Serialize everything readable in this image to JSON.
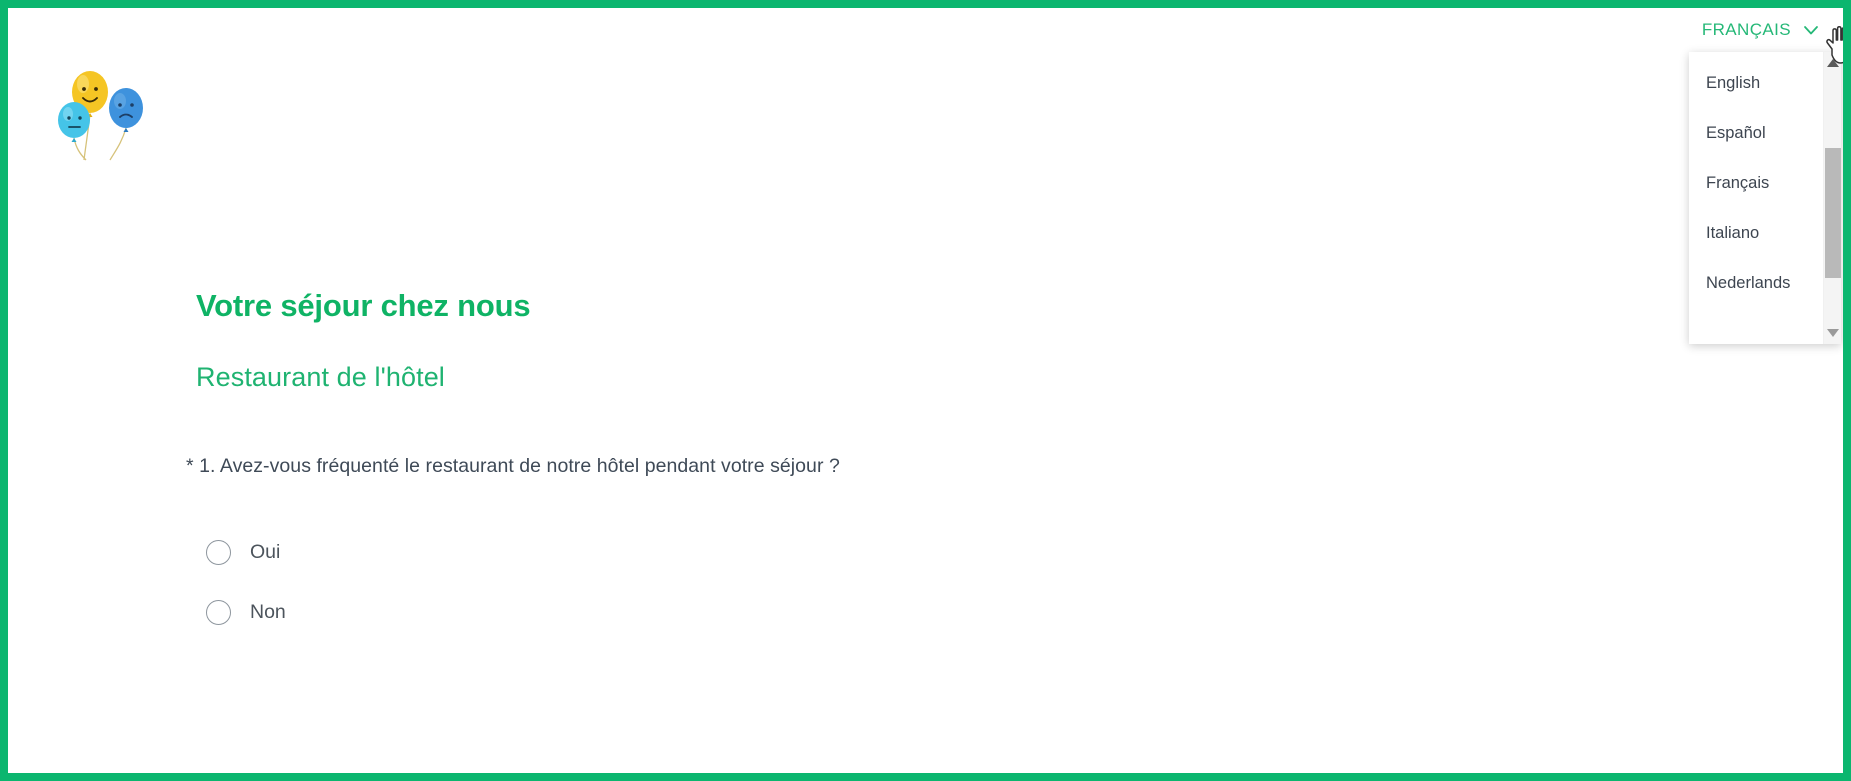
{
  "theme": {
    "border_color": "#0bb66f",
    "accent_green": "#0fb365",
    "subtitle_green": "#1fb371",
    "lang_green": "#25b877",
    "text_dark": "#3f4a57",
    "radio_border": "#8e969e",
    "scrollbar_thumb": "#b9b9b9"
  },
  "logo": {
    "name": "balloons-logo",
    "balloons": [
      {
        "face": "smiley",
        "color": "#f5c524"
      },
      {
        "face": "sad",
        "color": "#3e92dd"
      },
      {
        "face": "neutral",
        "color": "#45c4e8"
      }
    ]
  },
  "language_selector": {
    "current": "FRANÇAIS",
    "chevron_icon": "chevron-down-icon",
    "expanded": true,
    "options": [
      "English",
      "Español",
      "Français",
      "Italiano",
      "Nederlands"
    ],
    "scrollbar": {
      "up_arrow_icon": "triangle-up-icon",
      "down_arrow_icon": "triangle-down-icon"
    }
  },
  "cursor": {
    "icon": "pointer-hand-cursor"
  },
  "survey": {
    "title": "Votre séjour chez nous",
    "subtitle": "Restaurant de l'hôtel",
    "question": {
      "required_marker": "*",
      "number": "1.",
      "text": "Avez-vous fréquenté le restaurant de notre hôtel pendant votre séjour ?",
      "full": "* 1. Avez-vous fréquenté le restaurant de notre hôtel pendant votre séjour ?",
      "options": [
        {
          "label": "Oui",
          "selected": false
        },
        {
          "label": "Non",
          "selected": false
        }
      ]
    }
  }
}
